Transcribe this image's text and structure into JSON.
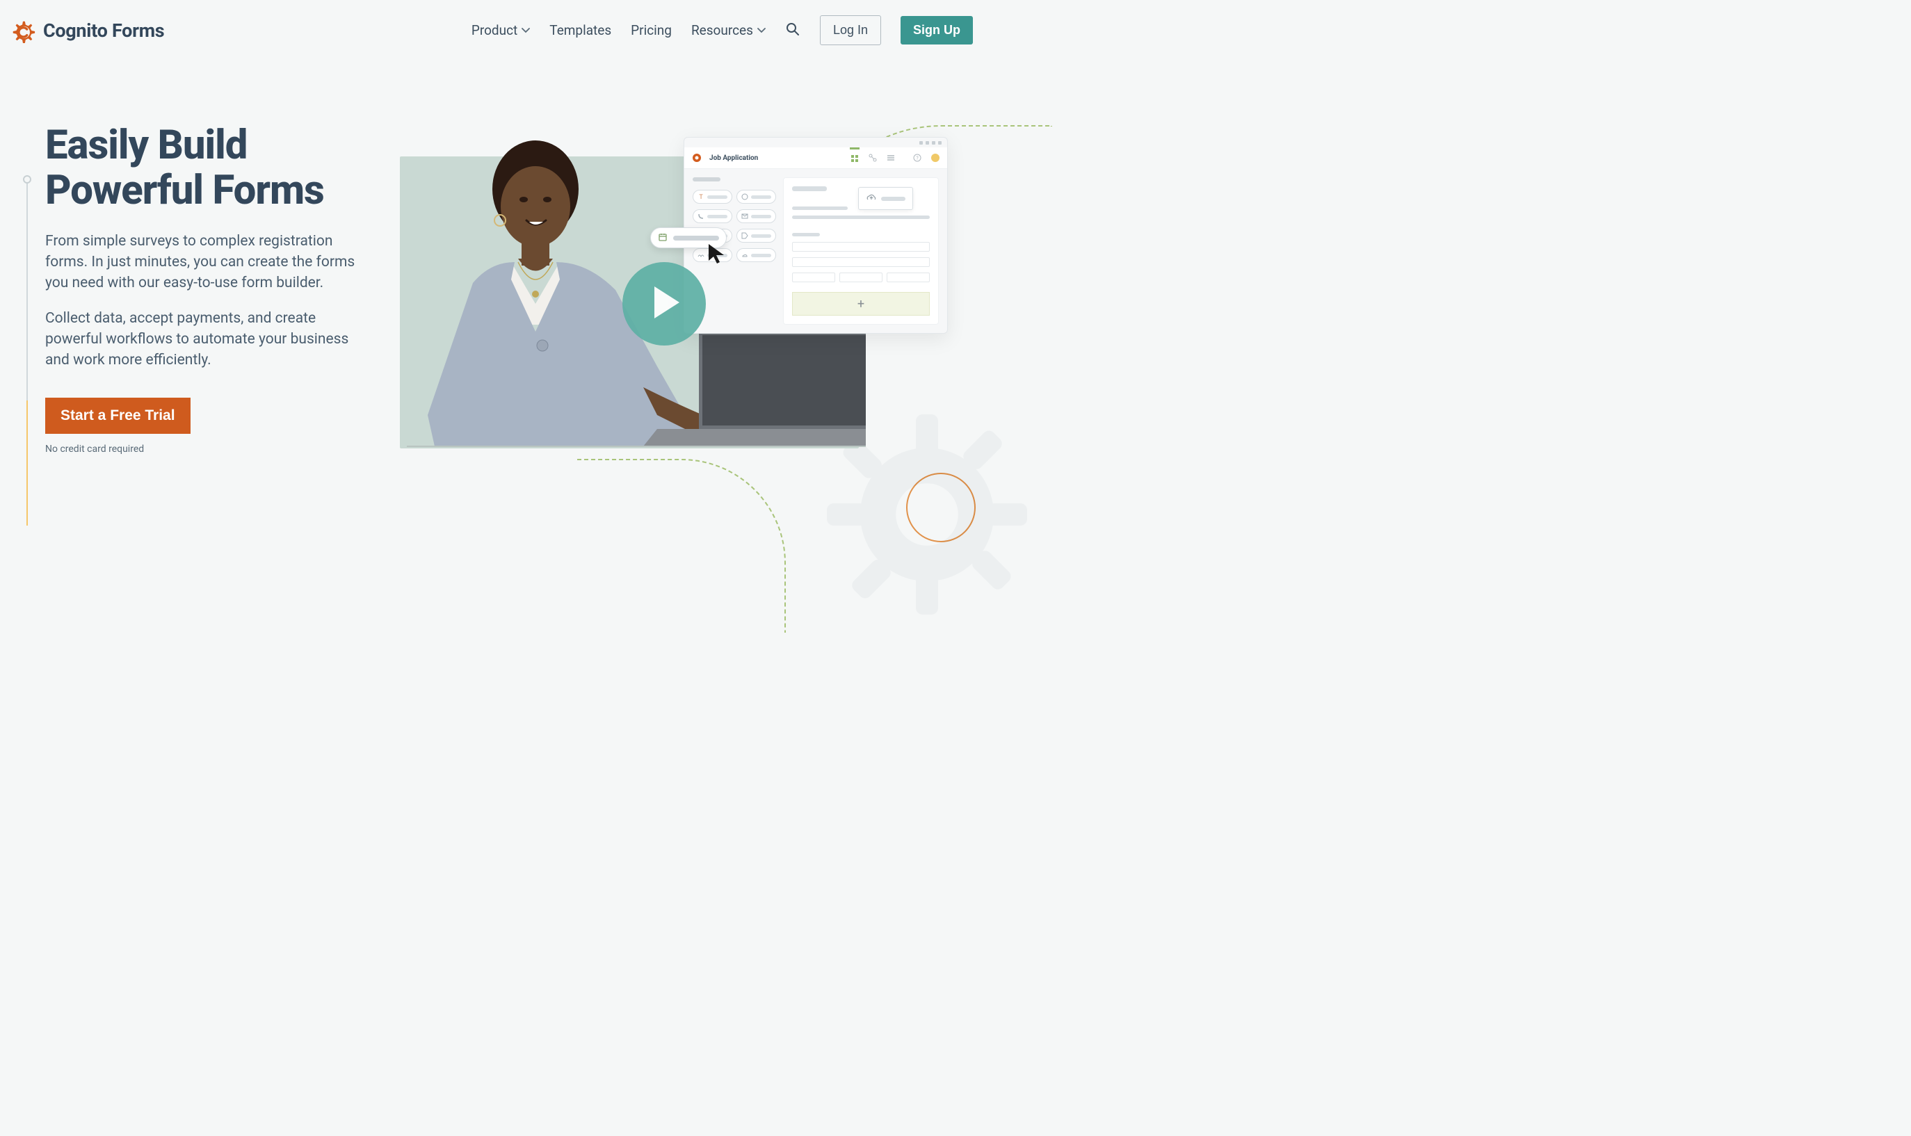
{
  "brand": {
    "name": "Cognito Forms"
  },
  "nav": {
    "product": "Product",
    "templates": "Templates",
    "pricing": "Pricing",
    "resources": "Resources",
    "login": "Log In",
    "signup": "Sign Up"
  },
  "hero": {
    "title_line1": "Easily Build",
    "title_line2": "Powerful Forms",
    "paragraph1": "From simple surveys to complex registration forms. In just minutes, you can create the forms you need with our easy-to-use form builder.",
    "paragraph2": "Collect data, accept payments, and create powerful workflows to automate your business and work more efficiently.",
    "cta": "Start a Free Trial",
    "note": "No credit card required"
  },
  "mockup": {
    "app_title": "Job Application",
    "add_button": "+"
  },
  "colors": {
    "brand_orange": "#d35c1e",
    "brand_teal": "#3a9690",
    "text_dark": "#33475b"
  }
}
